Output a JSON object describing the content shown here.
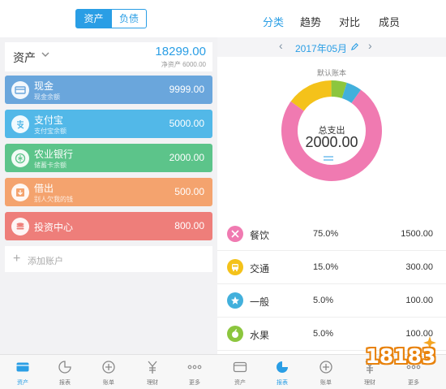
{
  "left": {
    "segment": {
      "assets": "资产",
      "liabilities": "负债"
    },
    "header": {
      "title": "资产",
      "total": "18299.00",
      "net": "净资产 6000.00"
    },
    "accounts": [
      {
        "name": "现金",
        "sub": "现金余额",
        "amount": "9999.00",
        "color": "#6aa6dc",
        "icon": "card-icon"
      },
      {
        "name": "支付宝",
        "sub": "支付宝余额",
        "amount": "5000.00",
        "color": "#52b8e8",
        "icon": "alipay-icon"
      },
      {
        "name": "农业银行",
        "sub": "储蓄卡余额",
        "amount": "2000.00",
        "color": "#5cc48a",
        "icon": "bank-icon"
      },
      {
        "name": "借出",
        "sub": "别人欠我的钱",
        "amount": "500.00",
        "color": "#f4a36e",
        "icon": "lend-icon"
      },
      {
        "name": "投资中心",
        "sub": "",
        "amount": "800.00",
        "color": "#ee7e7a",
        "icon": "invest-icon"
      }
    ],
    "add_account": "添加账户"
  },
  "right": {
    "tabs": [
      "分类",
      "趋势",
      "对比",
      "成员"
    ],
    "month": "2017年05月",
    "book": "默认账本",
    "total_label": "总支出",
    "total_value": "2000.00",
    "categories": [
      {
        "name": "餐饮",
        "percent": "75.0%",
        "amount": "1500.00",
        "color": "#f07ab1",
        "icon": "dining-icon"
      },
      {
        "name": "交通",
        "percent": "15.0%",
        "amount": "300.00",
        "color": "#f4c21a",
        "icon": "bus-icon"
      },
      {
        "name": "一般",
        "percent": "5.0%",
        "amount": "100.00",
        "color": "#42b0dc",
        "icon": "star-icon"
      },
      {
        "name": "水果",
        "percent": "5.0%",
        "amount": "100.00",
        "color": "#8cc63e",
        "icon": "apple-icon"
      }
    ],
    "donut_order": [
      1,
      3,
      2,
      0
    ]
  },
  "nav": {
    "left": [
      "资产",
      "报表",
      "账单",
      "理财",
      "更多"
    ],
    "right": [
      "资产",
      "报表",
      "账单",
      "理财",
      "更多"
    ]
  },
  "watermark": "18183",
  "colors": {
    "accent": "#2a9ee5"
  }
}
